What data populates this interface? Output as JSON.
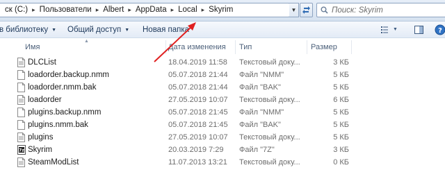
{
  "address_bar": {
    "crumbs": [
      "ск (C:)",
      "Пользователи",
      "Albert",
      "AppData",
      "Local",
      "Skyrim"
    ],
    "separator": "▸"
  },
  "search": {
    "placeholder": "Поиск: Skyrim"
  },
  "toolbar": {
    "library_label": "в библиотеку",
    "share_label": "Общий доступ",
    "new_folder_label": "Новая папка"
  },
  "columns": {
    "name": "Имя",
    "date": "Дата изменения",
    "type": "Тип",
    "size": "Размер"
  },
  "files": [
    {
      "name": "DLCList",
      "date": "18.04.2019 11:58",
      "type": "Текстовый доку...",
      "size": "3 КБ",
      "icon": "text-file-icon"
    },
    {
      "name": "loadorder.backup.nmm",
      "date": "05.07.2018 21:44",
      "type": "Файл \"NMM\"",
      "size": "5 КБ",
      "icon": "blank-file-icon"
    },
    {
      "name": "loadorder.nmm.bak",
      "date": "05.07.2018 21:44",
      "type": "Файл \"BAK\"",
      "size": "5 КБ",
      "icon": "blank-file-icon"
    },
    {
      "name": "loadorder",
      "date": "27.05.2019 10:07",
      "type": "Текстовый доку...",
      "size": "6 КБ",
      "icon": "text-file-icon"
    },
    {
      "name": "plugins.backup.nmm",
      "date": "05.07.2018 21:45",
      "type": "Файл \"NMM\"",
      "size": "5 КБ",
      "icon": "blank-file-icon"
    },
    {
      "name": "plugins.nmm.bak",
      "date": "05.07.2018 21:45",
      "type": "Файл \"BAK\"",
      "size": "5 КБ",
      "icon": "blank-file-icon"
    },
    {
      "name": "plugins",
      "date": "27.05.2019 10:07",
      "type": "Текстовый доку...",
      "size": "5 КБ",
      "icon": "text-file-icon"
    },
    {
      "name": "Skyrim",
      "date": "20.03.2019 7:29",
      "type": "Файл \"7Z\"",
      "size": "3 КБ",
      "icon": "archive-file-icon"
    },
    {
      "name": "SteamModList",
      "date": "11.07.2013 13:21",
      "type": "Текстовый доку...",
      "size": "0 КБ",
      "icon": "text-file-icon"
    }
  ],
  "colors": {
    "accent": "#1e395b",
    "annotation_arrow": "#e02020"
  }
}
